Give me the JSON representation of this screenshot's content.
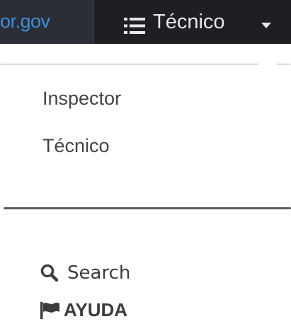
{
  "navbar": {
    "site_link_text": "or.gov",
    "role_toggle_label": "Técnico"
  },
  "dropdown": {
    "items": [
      {
        "label": "Inspector"
      },
      {
        "label": "Técnico"
      }
    ]
  },
  "links": {
    "search_label": "Search",
    "help_label": "AYUDA"
  },
  "colors": {
    "navbar_bg": "#1e1f23",
    "site_link_bg": "#2b2e34",
    "site_link_text": "#3d8ee0",
    "navbar_text": "#e6e7e9",
    "menu_text": "#444444",
    "link_text": "#3c3c3c"
  },
  "icons": {
    "role_toggle": "list-icon",
    "role_caret": "caret-down-icon",
    "search": "search-icon",
    "help": "flag-icon"
  }
}
